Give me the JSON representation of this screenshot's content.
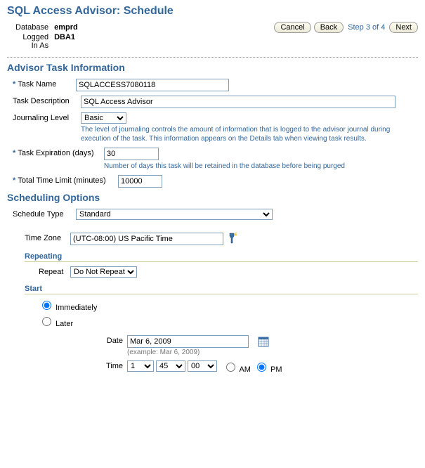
{
  "page": {
    "title": "SQL Access Advisor: Schedule"
  },
  "header": {
    "db_label": "Database",
    "db_value": "emprd",
    "login_label_line1": "Logged",
    "login_label_line2": "In As",
    "login_value": "DBA1",
    "cancel": "Cancel",
    "back": "Back",
    "step": "Step 3 of 4",
    "next": "Next"
  },
  "task_info": {
    "section": "Advisor Task Information",
    "name_label": "Task Name",
    "name_value": "SQLACCESS7080118",
    "desc_label": "Task Description",
    "desc_value": "SQL Access Advisor",
    "journal_label": "Journaling Level",
    "journal_value": "Basic",
    "journal_hint": "The level of journaling controls the amount of information that is logged to the advisor journal during execution of the task. This information appears on the Details tab when viewing task results.",
    "expire_label": "Task Expiration (days)",
    "expire_value": "30",
    "expire_hint": "Number of days this task will be retained in the database before being purged",
    "timelimit_label": "Total Time Limit (minutes)",
    "timelimit_value": "10000"
  },
  "schedule": {
    "section": "Scheduling Options",
    "type_label": "Schedule Type",
    "type_value": "Standard",
    "tz_label": "Time Zone",
    "tz_value": "(UTC-08:00) US Pacific Time",
    "repeating_section": "Repeating",
    "repeat_label": "Repeat",
    "repeat_value": "Do Not Repeat",
    "start_section": "Start",
    "start_immediately": "Immediately",
    "start_later": "Later",
    "date_label": "Date",
    "date_value": "Mar 6, 2009",
    "date_example": "(example: Mar 6, 2009)",
    "time_label": "Time",
    "time_hour": "1",
    "time_min": "45",
    "time_sec": "00",
    "am": "AM",
    "pm": "PM"
  }
}
